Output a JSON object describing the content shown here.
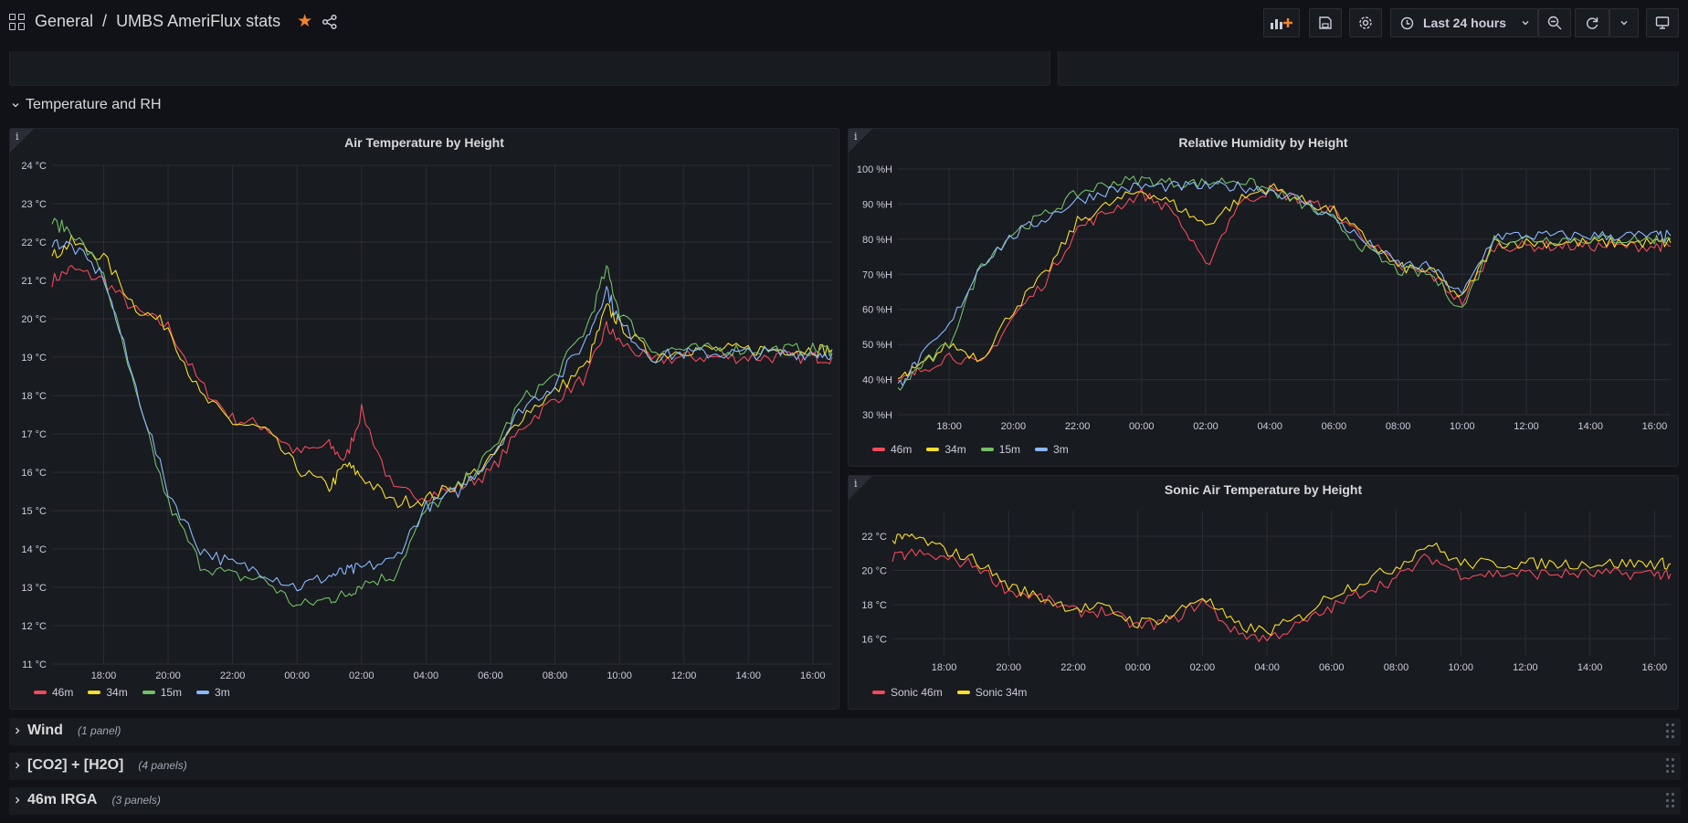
{
  "breadcrumb": {
    "folder": "General",
    "separator": "/",
    "dashboard": "UMBS AmeriFlux stats"
  },
  "toolbar": {
    "time_range": "Last 24 hours"
  },
  "section": {
    "title": "Temperature and RH"
  },
  "colors": {
    "s46": "#f2495c",
    "s34": "#fade2a",
    "s15": "#73bf69",
    "s3": "#8ab8ff",
    "accent": "#f5832a"
  },
  "panels": {
    "air": {
      "title": "Air Temperature by Height",
      "info": "i",
      "legend": [
        "46m",
        "34m",
        "15m",
        "3m"
      ]
    },
    "rh": {
      "title": "Relative Humidity by Height",
      "info": "i",
      "legend": [
        "46m",
        "34m",
        "15m",
        "3m"
      ]
    },
    "sonic": {
      "title": "Sonic Air Temperature by Height",
      "info": "i",
      "legend": [
        "Sonic 46m",
        "Sonic 34m"
      ]
    }
  },
  "rows": [
    {
      "title": "Wind",
      "count": "(1 panel)"
    },
    {
      "title": "[CO2] + [H2O]",
      "count": "(4 panels)"
    },
    {
      "title": "46m IRGA",
      "count": "(3 panels)"
    }
  ],
  "chart_data": [
    {
      "type": "line",
      "title": "Air Temperature by Height",
      "xlabel": "",
      "ylabel": "",
      "x_ticks": [
        "18:00",
        "20:00",
        "22:00",
        "00:00",
        "02:00",
        "04:00",
        "06:00",
        "08:00",
        "10:00",
        "12:00",
        "14:00",
        "16:00"
      ],
      "y_ticks": [
        "24 °C",
        "23 °C",
        "22 °C",
        "21 °C",
        "20 °C",
        "19 °C",
        "18 °C",
        "17 °C",
        "16 °C",
        "15 °C",
        "14 °C",
        "13 °C",
        "12 °C",
        "11 °C"
      ],
      "ylim": [
        11,
        24
      ],
      "x_hours": [
        -1.6,
        -1,
        0,
        1,
        2,
        3,
        4,
        5,
        6,
        7,
        7.5,
        8,
        9,
        10,
        11,
        12,
        13,
        14,
        15,
        15.6,
        16,
        17,
        18,
        19,
        20,
        21,
        22,
        22.6
      ],
      "series": [
        {
          "name": "46m",
          "color_key": "s46",
          "values": [
            21.0,
            21.3,
            21.0,
            20.2,
            19.8,
            18.3,
            17.4,
            17.2,
            16.5,
            16.7,
            16.3,
            17.6,
            15.5,
            15.4,
            15.6,
            16.0,
            17.2,
            17.9,
            18.5,
            19.8,
            19.4,
            18.9,
            19.0,
            19.0,
            19.0,
            19.0,
            19.0,
            19.0
          ]
        },
        {
          "name": "34m",
          "color_key": "s34",
          "values": [
            21.6,
            22.0,
            21.6,
            20.3,
            19.8,
            18.0,
            17.3,
            17.1,
            16.1,
            15.6,
            16.2,
            15.9,
            15.2,
            15.3,
            15.7,
            16.3,
            17.5,
            18.1,
            18.8,
            20.3,
            19.9,
            19.0,
            19.2,
            19.2,
            19.2,
            19.2,
            19.2,
            19.2
          ]
        },
        {
          "name": "15m",
          "color_key": "s15",
          "values": [
            22.5,
            22.3,
            21.2,
            18.0,
            15.2,
            13.6,
            13.3,
            13.2,
            12.5,
            12.7,
            12.8,
            13.1,
            13.3,
            15.0,
            15.6,
            16.5,
            17.9,
            18.5,
            19.8,
            21.3,
            20.2,
            19.2,
            19.2,
            19.2,
            19.2,
            19.2,
            19.2,
            19.2
          ]
        },
        {
          "name": "3m",
          "color_key": "s3",
          "values": [
            22.0,
            21.9,
            21.1,
            18.2,
            15.5,
            14.0,
            13.6,
            13.4,
            13.0,
            13.3,
            13.4,
            13.5,
            13.7,
            15.1,
            15.5,
            16.4,
            17.7,
            18.3,
            19.5,
            20.8,
            19.9,
            19.0,
            19.1,
            19.1,
            19.1,
            19.1,
            19.1,
            19.1
          ]
        }
      ]
    },
    {
      "type": "line",
      "title": "Relative Humidity by Height",
      "x_ticks": [
        "18:00",
        "20:00",
        "22:00",
        "00:00",
        "02:00",
        "04:00",
        "06:00",
        "08:00",
        "10:00",
        "12:00",
        "14:00",
        "16:00"
      ],
      "y_ticks": [
        "100 %H",
        "90 %H",
        "80 %H",
        "70 %H",
        "60 %H",
        "50 %H",
        "40 %H",
        "30 %H"
      ],
      "ylim": [
        30,
        100
      ],
      "x_hours": [
        -1.6,
        -1,
        0,
        1,
        2,
        3,
        4,
        5,
        6,
        7,
        8,
        9,
        10,
        11,
        12,
        13,
        14,
        15,
        16,
        17,
        18,
        19,
        20,
        21,
        22,
        22.5
      ],
      "series": [
        {
          "name": "46m",
          "color_key": "s46",
          "values": [
            39,
            42,
            47,
            44,
            58,
            68,
            83,
            88,
            93,
            88,
            72,
            90,
            94,
            91,
            88,
            80,
            72,
            70,
            62,
            78,
            78,
            78,
            78,
            78,
            78,
            78
          ]
        },
        {
          "name": "34m",
          "color_key": "s34",
          "values": [
            40,
            43,
            50,
            46,
            60,
            70,
            85,
            90,
            94,
            90,
            84,
            91,
            95,
            91,
            88,
            80,
            72,
            71,
            63,
            79,
            79,
            79,
            79,
            79,
            79,
            79
          ]
        },
        {
          "name": "15m",
          "color_key": "s15",
          "values": [
            37,
            43,
            50,
            73,
            82,
            87,
            93,
            96,
            97,
            96,
            96,
            97,
            94,
            90,
            85,
            77,
            71,
            70,
            60,
            80,
            80,
            80,
            80,
            80,
            80,
            80
          ]
        },
        {
          "name": "3m",
          "color_key": "s3",
          "values": [
            38,
            45,
            55,
            73,
            81,
            86,
            91,
            94,
            95,
            95,
            95,
            95,
            94,
            91,
            86,
            79,
            73,
            72,
            64,
            81,
            81,
            81,
            81,
            81,
            81,
            81
          ]
        }
      ]
    },
    {
      "type": "line",
      "title": "Sonic Air Temperature by Height",
      "x_ticks": [
        "18:00",
        "20:00",
        "22:00",
        "00:00",
        "02:00",
        "04:00",
        "06:00",
        "08:00",
        "10:00",
        "12:00",
        "14:00",
        "16:00"
      ],
      "y_ticks": [
        "22 °C",
        "20 °C",
        "18 °C",
        "16 °C"
      ],
      "ylim": [
        15,
        23.5
      ],
      "x_hours": [
        -1.6,
        -1,
        0,
        1,
        2,
        3,
        4,
        5,
        6,
        7,
        8,
        9,
        10,
        11,
        12,
        13,
        14,
        15,
        16,
        17,
        18,
        19,
        20,
        21,
        22,
        22.5
      ],
      "series": [
        {
          "name": "Sonic 46m",
          "color_key": "s46",
          "values": [
            20.7,
            21.0,
            20.7,
            20.3,
            18.8,
            18.4,
            17.6,
            17.6,
            16.7,
            17.0,
            18.2,
            16.4,
            16.0,
            16.8,
            17.8,
            18.8,
            19.5,
            20.8,
            19.8,
            19.8,
            19.8,
            19.8,
            19.8,
            19.8,
            19.8,
            19.8
          ]
        },
        {
          "name": "Sonic 34m",
          "color_key": "s34",
          "values": [
            21.7,
            22.0,
            21.2,
            20.6,
            19.1,
            18.4,
            17.8,
            17.8,
            16.9,
            17.3,
            18.5,
            16.8,
            16.4,
            17.2,
            18.6,
            19.4,
            20.2,
            21.6,
            20.4,
            20.4,
            20.4,
            20.4,
            20.4,
            20.4,
            20.4,
            20.4
          ]
        }
      ]
    }
  ]
}
